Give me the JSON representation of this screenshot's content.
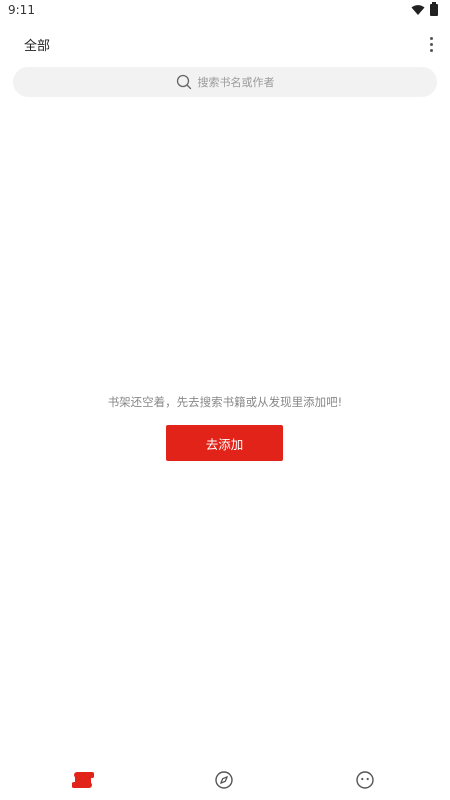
{
  "status_bar": {
    "time": "9:11",
    "icons": [
      "wifi-icon",
      "battery-icon"
    ]
  },
  "app_bar": {
    "title": "全部",
    "menu_icon": "more-vert-icon"
  },
  "search": {
    "placeholder": "搜索书名或作者",
    "icon": "search-icon"
  },
  "empty_state": {
    "message": "书架还空着，先去搜索书籍或从发现里添加吧!",
    "button_label": "去添加"
  },
  "bottom_nav": {
    "items": [
      {
        "icon": "bookshelf-icon",
        "active": true
      },
      {
        "icon": "compass-icon",
        "active": false
      },
      {
        "icon": "smiley-face-icon",
        "active": false
      }
    ]
  },
  "colors": {
    "accent": "#e2231a",
    "search_bg": "#f2f2f2",
    "inactive_icon": "#555555"
  }
}
